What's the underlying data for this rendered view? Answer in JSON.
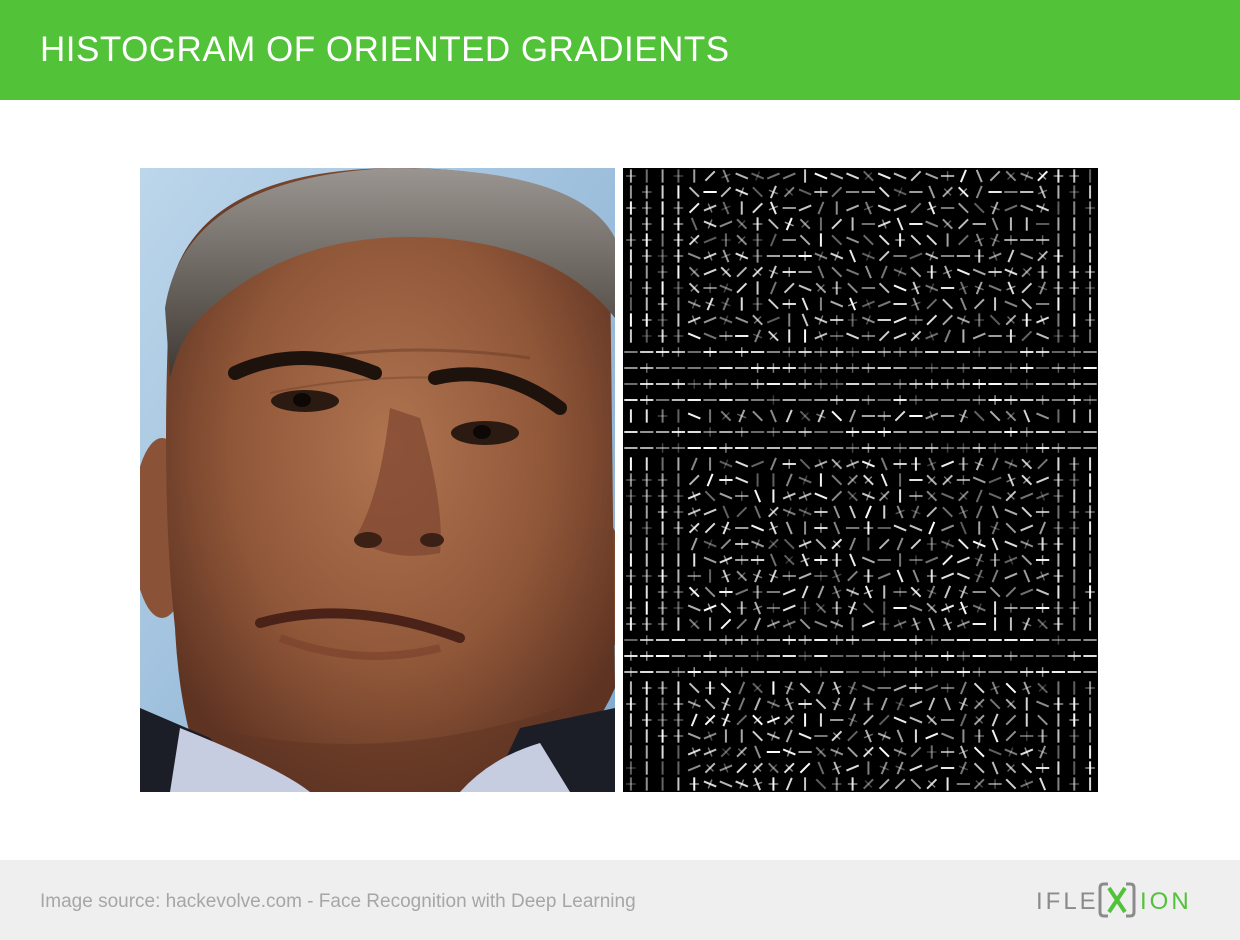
{
  "header": {
    "title": "HISTOGRAM OF ORIENTED GRADIENTS",
    "background": "#52c239"
  },
  "figure": {
    "photo_icon": "face-portrait-photo",
    "hog_icon": "hog-visualization"
  },
  "footer": {
    "source_text": "Image source: hackevolve.com - Face Recognition with Deep Learning",
    "logo_text": "IFLEXION",
    "logo_color": "#52c239",
    "logo_gray": "#888888"
  }
}
